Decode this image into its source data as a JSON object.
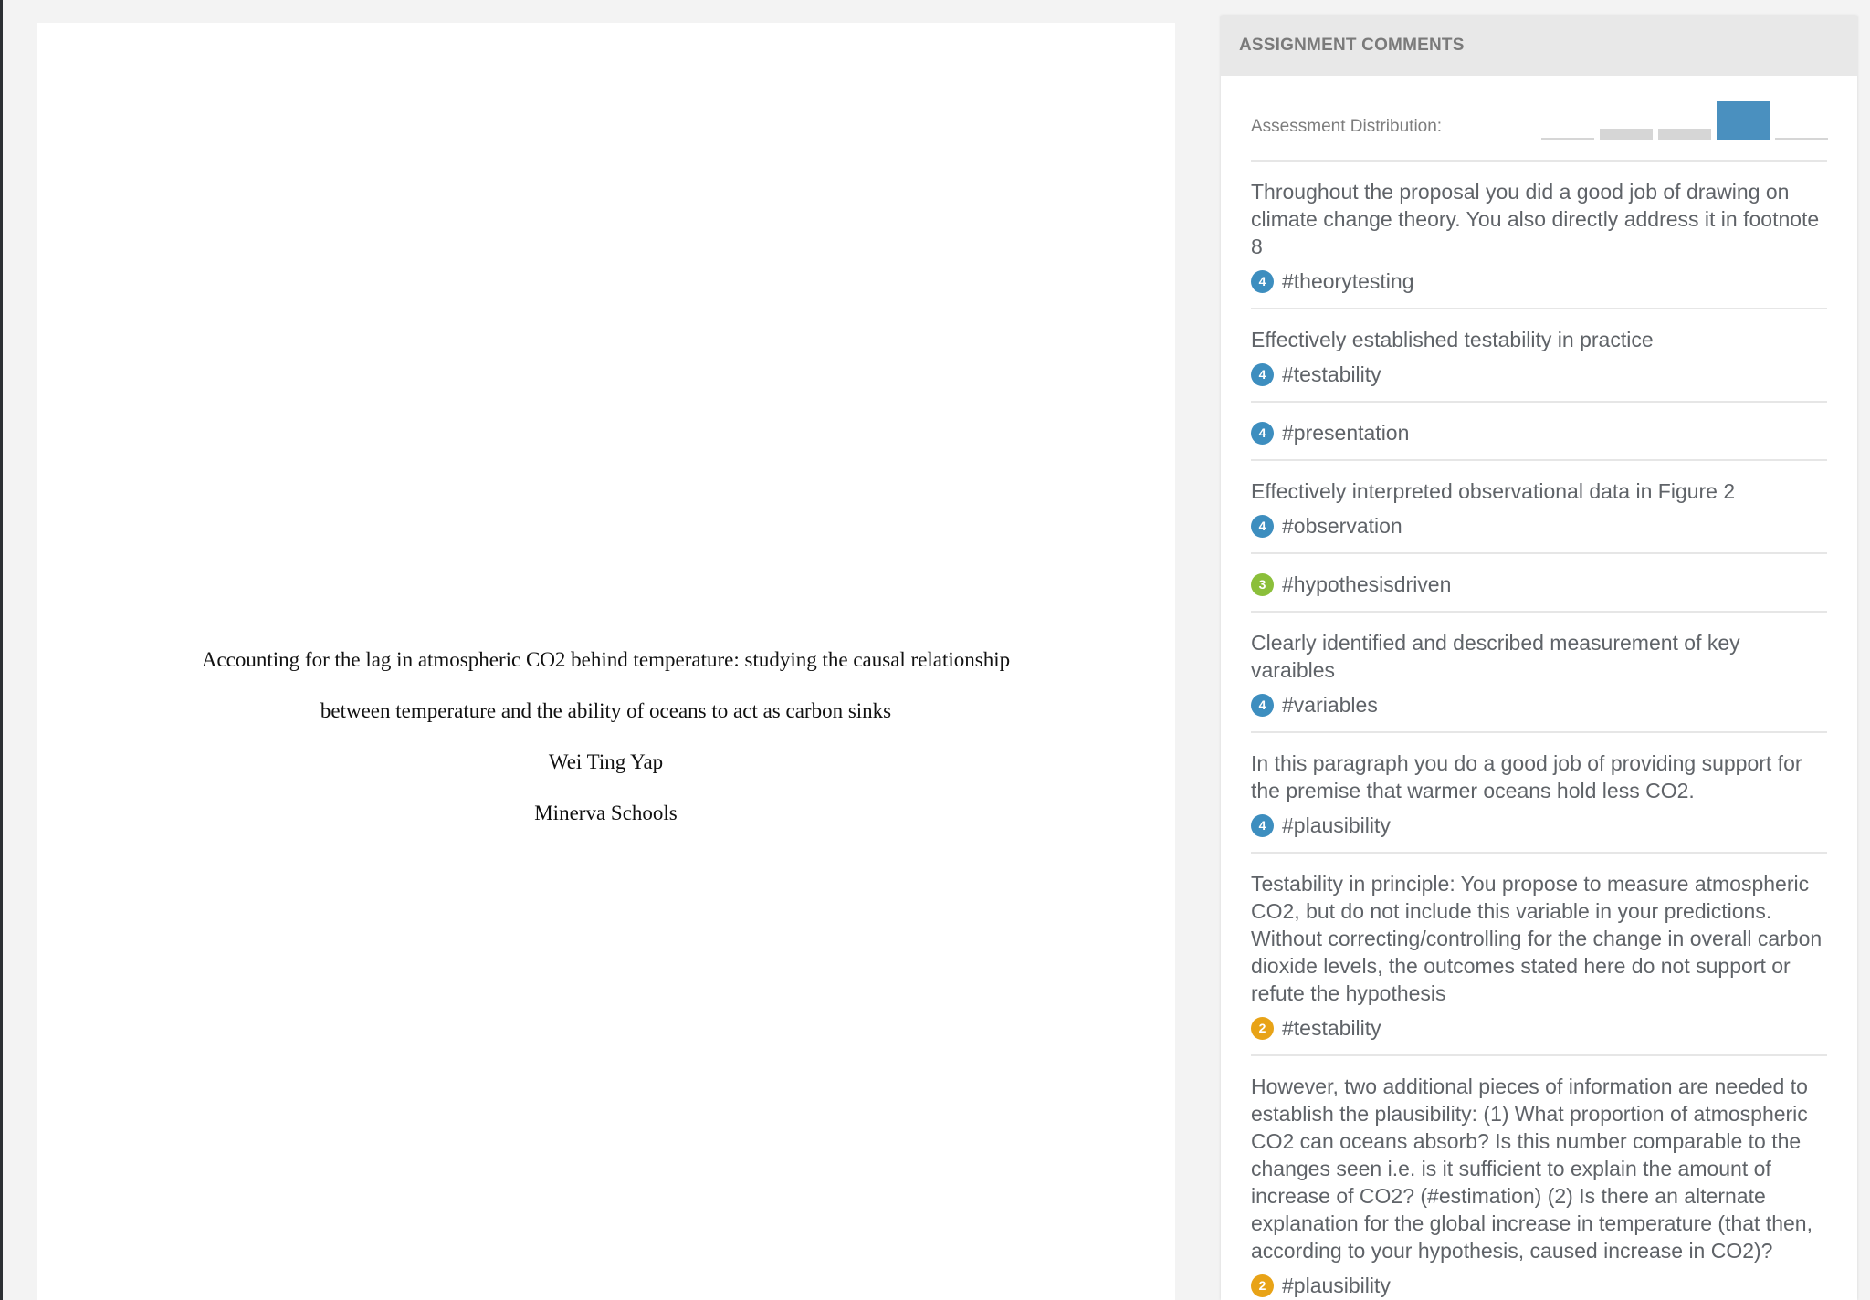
{
  "document": {
    "title_line1": "Accounting for the lag in atmospheric CO2 behind temperature: studying the causal relationship",
    "title_line2": "between temperature and the ability of oceans to act as carbon sinks",
    "author": "Wei Ting Yap",
    "institution": "Minerva Schools"
  },
  "panel": {
    "header": "ASSIGNMENT COMMENTS",
    "distribution_label": "Assessment Distribution:"
  },
  "chart_data": {
    "type": "bar",
    "categories": [
      "1",
      "2",
      "3",
      "4",
      "5"
    ],
    "values": [
      0,
      2,
      2,
      7,
      0
    ],
    "highlight_index": 3,
    "colors": {
      "default": "#d6d6d6",
      "highlight": "#4a90bf",
      "baseline": "#d6d6d6"
    }
  },
  "score_colors": {
    "2": "#e8a317",
    "3": "#8bbf3a",
    "4": "#3d8ebf"
  },
  "comments": [
    {
      "text": "Throughout the proposal you did a good job of drawing on climate change theory. You also directly address it in footnote 8",
      "score": "4",
      "tag": "#theorytesting"
    },
    {
      "text": "Effectively established testability in practice",
      "score": "4",
      "tag": "#testability"
    },
    {
      "text": "",
      "score": "4",
      "tag": "#presentation"
    },
    {
      "text": "Effectively interpreted observational data in Figure 2",
      "score": "4",
      "tag": "#observation"
    },
    {
      "text": "",
      "score": "3",
      "tag": "#hypothesisdriven"
    },
    {
      "text": "Clearly identified and described measurement of key varaibles",
      "score": "4",
      "tag": "#variables"
    },
    {
      "text": "In this paragraph you do a good job of providing support for the premise that warmer oceans hold less CO2.",
      "score": "4",
      "tag": "#plausibility"
    },
    {
      "text": "Testability in principle: You propose to measure atmospheric CO2, but do not include this variable in your predictions. Without correcting/controlling for the change in overall carbon dioxide levels, the outcomes stated here do not support or refute the hypothesis",
      "score": "2",
      "tag": "#testability"
    },
    {
      "text": "However, two additional pieces of information are needed to establish the plausibility: (1) What proportion of atmospheric CO2 can oceans absorb? Is this number comparable to the changes seen i.e. is it sufficient to explain the amount of increase of CO2? (#estimation) (2) Is there an alternate explanation for the global increase in temperature (that then, according to your hypothesis, caused increase in CO2)?",
      "score": "2",
      "tag": "#plausibility"
    }
  ]
}
